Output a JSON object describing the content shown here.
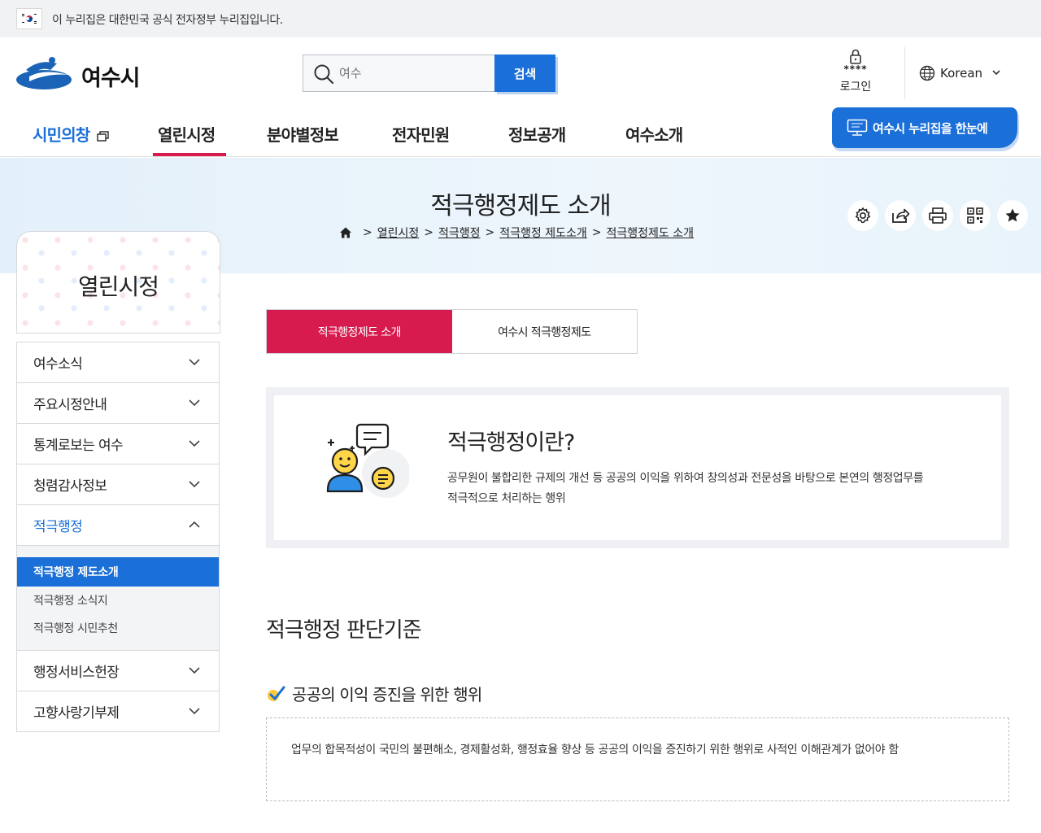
{
  "gov_banner": {
    "text": "이 누리집은 대한민국 공식 전자정부 누리집입니다."
  },
  "header": {
    "logo_text": "여수시",
    "search_placeholder": "여수",
    "search_button": "검색",
    "login_stars": "****",
    "login_label": "로그인",
    "language": "Korean"
  },
  "gnb": {
    "items": [
      "시민의창",
      "열린시정",
      "분야별정보",
      "전자민원",
      "정보공개",
      "여수소개"
    ],
    "all_menu_label": "여수시 누리집을 한눈에"
  },
  "hero": {
    "title": "적극행정제도 소개",
    "breadcrumb": [
      "열린시정",
      "적극행정",
      "적극행정 제도소개",
      "적극행정제도 소개"
    ],
    "separator": ">"
  },
  "lnb": {
    "title": "열린시정",
    "items": [
      {
        "label": "여수소식"
      },
      {
        "label": "주요시정안내"
      },
      {
        "label": "통계로보는 여수"
      },
      {
        "label": "청렴감사정보"
      },
      {
        "label": "적극행정"
      },
      {
        "label": "행정서비스헌장"
      },
      {
        "label": "고향사랑기부제"
      }
    ],
    "sub_items": [
      "적극행정 제도소개",
      "적극행정 소식지",
      "적극행정 시민추천"
    ]
  },
  "content": {
    "tabs": [
      "적극행정제도 소개",
      "여수시 적극행정제도"
    ],
    "intro_heading": "적극행정이란?",
    "intro_line1": "공무원이 불합리한 규제의 개선 등 공공의 이익을 위하여 창의성과 전문성을 바탕으로 본연의 행정업무를",
    "intro_line2": "적극적으로 처리하는 행위",
    "section_title": "적극행정 판단기준",
    "sub_heading": "공공의 이익 증진을 위한 행위",
    "note_text": "업무의 합목적성이 국민의 불편해소, 경제활성화, 행정효율 향상 등 공공의 이익을 증진하기 위한 행위로 사적인 이해관계가 없어야 함"
  },
  "colors": {
    "primary_blue": "#1a6fd8",
    "accent_red": "#d81b4f"
  }
}
